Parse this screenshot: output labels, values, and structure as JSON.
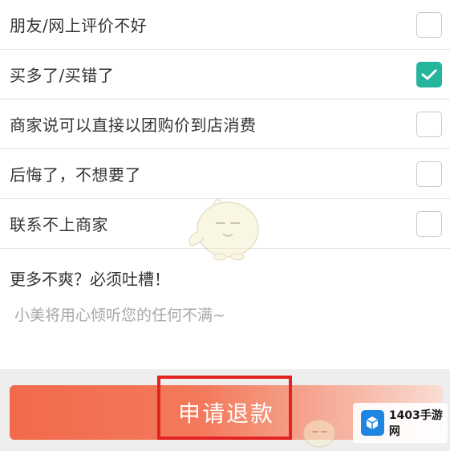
{
  "reasons": [
    {
      "label": "朋友/网上评价不好",
      "checked": false
    },
    {
      "label": "买多了/买错了",
      "checked": true
    },
    {
      "label": "商家说可以直接以团购价到店消费",
      "checked": false
    },
    {
      "label": "后悔了，不想要了",
      "checked": false
    },
    {
      "label": "联系不上商家",
      "checked": false
    }
  ],
  "more": {
    "title": "更多不爽？必须吐槽！",
    "placeholder": "小美将用心倾听您的任何不满~",
    "value": ""
  },
  "refund_button": {
    "label": "申请退款"
  },
  "watermark": {
    "site_name": "1403手游网"
  },
  "colors": {
    "check_accent": "#25b49c",
    "button_start": "#f26a4b",
    "highlight": "#e52222",
    "logo_blue": "#1e86e0"
  },
  "icons": {
    "checkmark": "check-icon",
    "mascot": "mascot-watermark",
    "logo": "cube-logo-icon"
  }
}
